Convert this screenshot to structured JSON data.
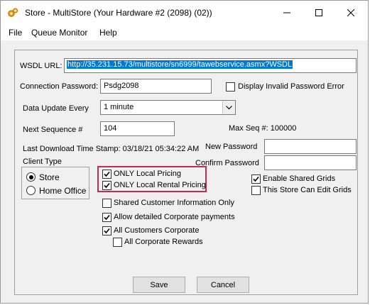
{
  "window": {
    "title": "Store - MultiStore (Your Hardware #2 (2098) (02))"
  },
  "menu": [
    "File",
    "Queue Monitor",
    "Help"
  ],
  "form": {
    "wsdl_label": "WSDL URL:",
    "wsdl_value": "http://35.231.15.73/multistore/sn6999/tawebservice.asmx?WSDL",
    "conn_pwd_label": "Connection Password:",
    "conn_pwd_value": "Psdg2098",
    "display_invalid_label": "Display Invalid Password Error",
    "data_update_label": "Data Update Every",
    "data_update_value": "1 minute",
    "next_seq_label": "Next Sequence #",
    "next_seq_value": "104",
    "max_seq_text": "Max Seq #: 100000",
    "last_download_text": "Last Download Time Stamp: 03/18/21 05:34:22 AM",
    "new_password_label": "New Password",
    "confirm_password_label": "Confirm Password",
    "client_type_label": "Client Type",
    "radio_store": "Store",
    "radio_home_office": "Home Office",
    "only_local_pricing": "ONLY Local Pricing",
    "only_local_rental_pricing": "ONLY Local Rental Pricing",
    "enable_shared_grids": "Enable Shared Grids",
    "store_can_edit_grids": "This Store Can Edit Grids",
    "shared_customer_info": "Shared Customer Information Only",
    "allow_detailed_payments": "Allow detailed Corporate payments",
    "all_customers_corporate": "All Customers Corporate",
    "all_corporate_rewards": "All Corporate Rewards",
    "save_label": "Save",
    "cancel_label": "Cancel"
  },
  "state": {
    "display_invalid_checked": false,
    "client_type_selected": "Store",
    "only_local_pricing_checked": true,
    "only_local_rental_pricing_checked": true,
    "enable_shared_grids_checked": true,
    "store_can_edit_grids_checked": false,
    "shared_customer_info_checked": false,
    "allow_detailed_payments_checked": true,
    "all_customers_corporate_checked": true,
    "all_corporate_rewards_checked": false
  },
  "colors": {
    "highlight_border": "#c42b52",
    "selection": "#0078d7"
  },
  "icons": [
    "gears-icon",
    "minimize-icon",
    "maximize-icon",
    "close-icon",
    "chevron-down-icon",
    "checkmark-icon"
  ]
}
